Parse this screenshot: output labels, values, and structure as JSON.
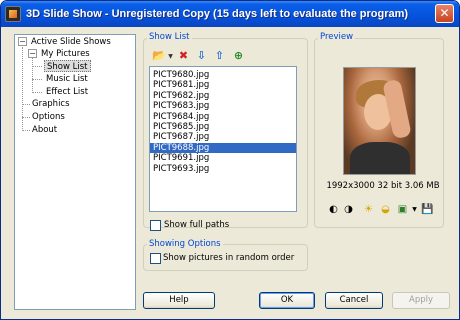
{
  "window": {
    "title": "3D Slide Show - Unregistered Copy (15 days left to evaluate the program)",
    "close_glyph": "✕"
  },
  "tree": {
    "root": "Active Slide Shows",
    "child": "My Pictures",
    "subitems": [
      "Show List",
      "Music List",
      "Effect List"
    ],
    "top_level": [
      "Graphics",
      "Options",
      "About"
    ],
    "expander_glyph": "−",
    "selected": "Show List"
  },
  "show_list": {
    "group_label": "Show List",
    "toolbar_icons": [
      "add-folder-icon",
      "delete-icon",
      "move-down-icon",
      "move-up-icon",
      "add-picture-icon"
    ],
    "toolbar_glyphs": [
      "📂",
      "✖",
      "⇩",
      "⇧",
      "⊕"
    ],
    "files": [
      "PICT9680.jpg",
      "PICT9681.jpg",
      "PICT9682.jpg",
      "PICT9683.jpg",
      "PICT9684.jpg",
      "PICT9685.jpg",
      "PICT9687.jpg",
      "PICT9688.jpg",
      "PICT9691.jpg",
      "PICT9693.jpg"
    ],
    "selected_index": 7,
    "show_full_paths_label": "Show full paths",
    "show_full_paths_checked": false
  },
  "showing_options": {
    "group_label": "Showing Options",
    "random_order_label": "Show pictures in random order",
    "random_order_checked": false
  },
  "preview": {
    "group_label": "Preview",
    "info": "1992x3000  32 bit  3.06 MB",
    "icons": [
      "rotate-left-icon",
      "rotate-right-icon",
      "brightness-icon",
      "contrast-icon",
      "image-menu-icon",
      "save-icon"
    ],
    "glyphs": [
      "◐",
      "◑",
      "☀",
      "◒",
      "▣",
      "💾"
    ]
  },
  "buttons": {
    "help": "Help",
    "ok": "OK",
    "cancel": "Cancel",
    "apply": "Apply"
  },
  "colors": {
    "titlebar": "#0552dc",
    "selection": "#316ac5",
    "group_label": "#0046d5"
  }
}
